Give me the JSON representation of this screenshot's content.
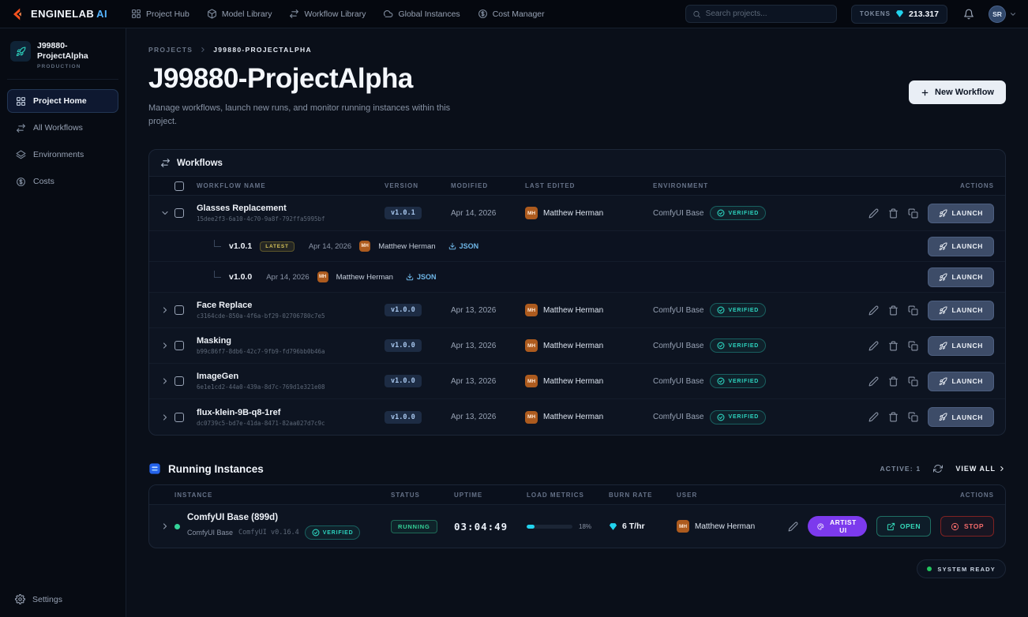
{
  "topnav": {
    "brand_main": "ENGINELAB",
    "brand_accent": "AI",
    "items": [
      {
        "label": "Project Hub"
      },
      {
        "label": "Model Library"
      },
      {
        "label": "Workflow Library"
      },
      {
        "label": "Global Instances"
      },
      {
        "label": "Cost Manager"
      }
    ],
    "search_placeholder": "Search projects...",
    "tokens_label": "TOKENS",
    "tokens_value": "213.317",
    "avatar_initials": "SR"
  },
  "sidebar": {
    "project_name": "J99880-ProjectAlpha",
    "project_badge": "PRODUCTION",
    "items": [
      {
        "label": "Project Home"
      },
      {
        "label": "All Workflows"
      },
      {
        "label": "Environments"
      },
      {
        "label": "Costs"
      }
    ],
    "settings_label": "Settings"
  },
  "page": {
    "breadcrumb_root": "PROJECTS",
    "breadcrumb_current": "J99880-PROJECTALPHA",
    "title": "J99880-ProjectAlpha",
    "subtitle": "Manage workflows, launch new runs, and monitor running instances within this project.",
    "new_workflow_label": "New Workflow"
  },
  "workflows": {
    "panel_title": "Workflows",
    "columns": {
      "name": "WORKFLOW NAME",
      "version": "VERSION",
      "modified": "MODIFIED",
      "last_edited": "LAST EDITED",
      "environment": "ENVIRONMENT",
      "actions": "ACTIONS"
    },
    "launch_label": "LAUNCH",
    "verified_label": "VERIFIED",
    "rows": [
      {
        "name": "Glasses Replacement",
        "id": "15dee2f3-6a10-4c70-9a8f-792ffa5995bf",
        "version": "v1.0.1",
        "modified": "Apr 14, 2026",
        "editor_initials": "MH",
        "editor": "Matthew Herman",
        "environment": "ComfyUI Base"
      },
      {
        "name": "Face Replace",
        "id": "c3164cde-850a-4f6a-bf29-02706780c7e5",
        "version": "v1.0.0",
        "modified": "Apr 13, 2026",
        "editor_initials": "MH",
        "editor": "Matthew Herman",
        "environment": "ComfyUI Base"
      },
      {
        "name": "Masking",
        "id": "b99c86f7-8db6-42c7-9fb9-fd796bb0b46a",
        "version": "v1.0.0",
        "modified": "Apr 13, 2026",
        "editor_initials": "MH",
        "editor": "Matthew Herman",
        "environment": "ComfyUI Base"
      },
      {
        "name": "ImageGen",
        "id": "6e1e1cd2-44a0-439a-8d7c-769d1e321e08",
        "version": "v1.0.0",
        "modified": "Apr 13, 2026",
        "editor_initials": "MH",
        "editor": "Matthew Herman",
        "environment": "ComfyUI Base"
      },
      {
        "name": "flux-klein-9B-q8-1ref",
        "id": "dc0739c5-bd7e-41da-8471-82aa027d7c9c",
        "version": "v1.0.0",
        "modified": "Apr 13, 2026",
        "editor_initials": "MH",
        "editor": "Matthew Herman",
        "environment": "ComfyUI Base"
      }
    ],
    "expanded_versions": [
      {
        "version": "v1.0.1",
        "latest_badge": "LATEST",
        "date": "Apr 14, 2026",
        "editor_initials": "MH",
        "editor": "Matthew Herman",
        "json_label": "JSON"
      },
      {
        "version": "v1.0.0",
        "latest_badge": "",
        "date": "Apr 14, 2026",
        "editor_initials": "MH",
        "editor": "Matthew Herman",
        "json_label": "JSON"
      }
    ]
  },
  "instances": {
    "section_title": "Running Instances",
    "active_label": "ACTIVE: 1",
    "view_all_label": "VIEW ALL",
    "columns": {
      "instance": "INSTANCE",
      "status": "STATUS",
      "uptime": "UPTIME",
      "load": "LOAD METRICS",
      "burn": "BURN RATE",
      "user": "USER",
      "actions": "ACTIONS"
    },
    "rows": [
      {
        "name": "ComfyUI Base (899d)",
        "environment": "ComfyUI Base",
        "runtime": "ComfyUI v0.16.4",
        "verified_label": "VERIFIED",
        "status": "RUNNING",
        "uptime": "03:04:49",
        "load_pct": 18,
        "load_label": "18%",
        "burn_rate": "6 T/hr",
        "user_initials": "MH",
        "user": "Matthew Herman",
        "artist_ui_label": "ARTIST UI",
        "open_label": "OPEN",
        "stop_label": "STOP"
      }
    ]
  },
  "footer": {
    "system_ready_label": "SYSTEM READY"
  }
}
